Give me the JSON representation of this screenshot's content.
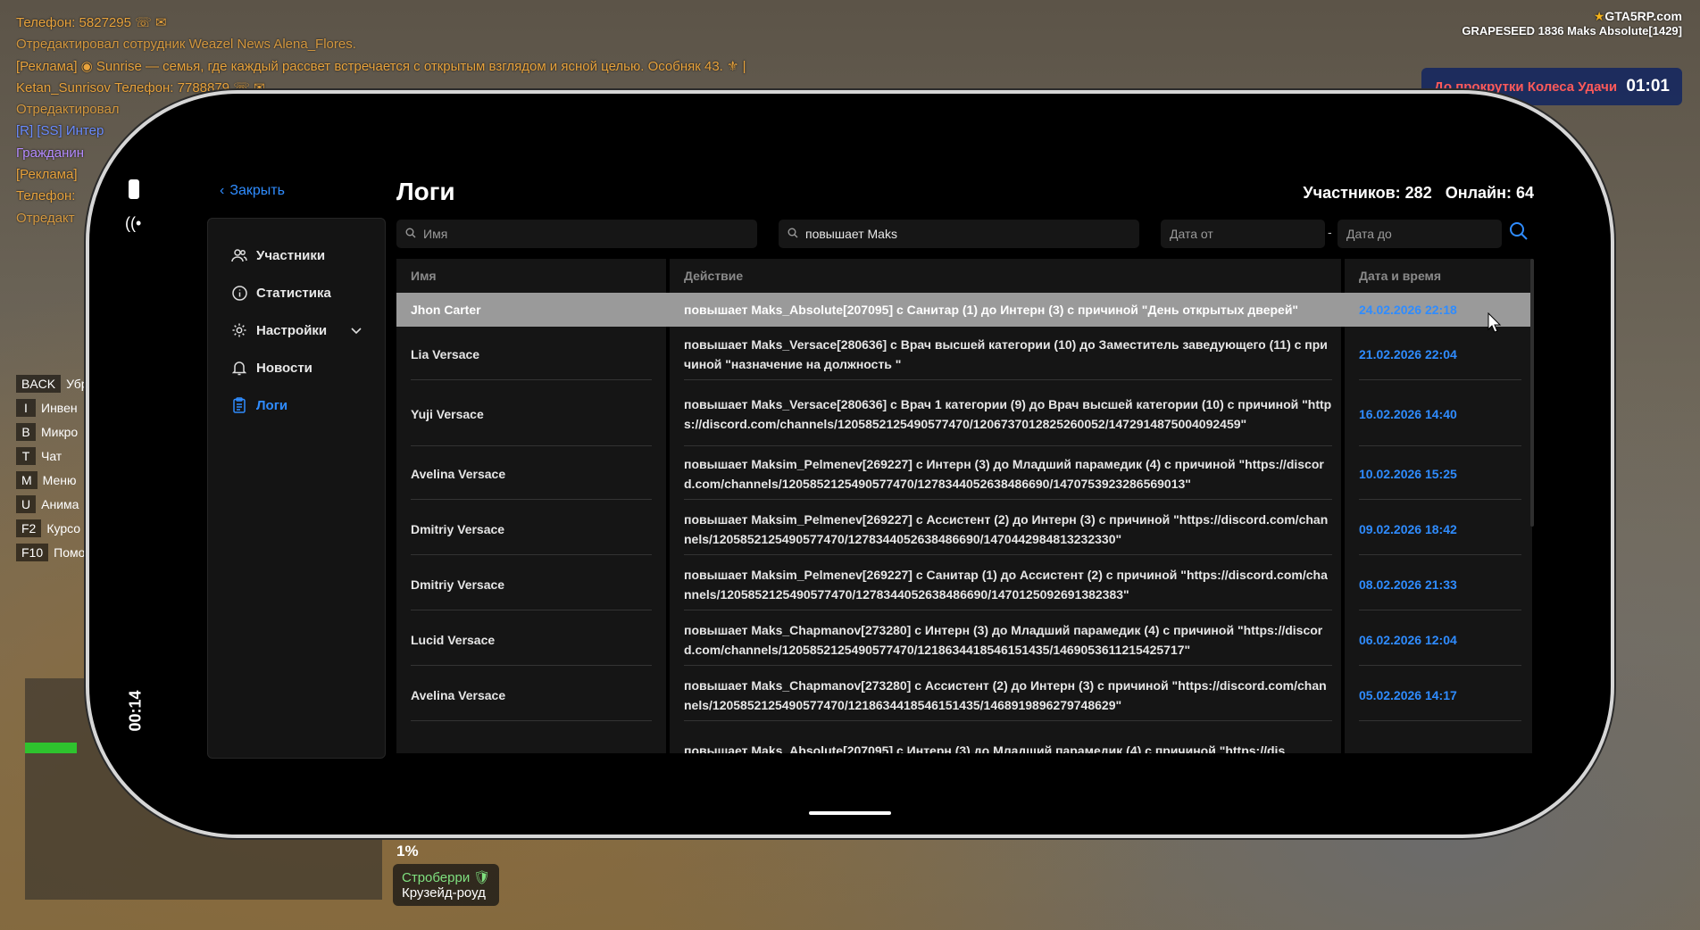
{
  "chat": [
    {
      "text": "Телефон: 5827295 ☏ ✉",
      "color": "orange"
    },
    {
      "text": "Отредактировал сотрудник Weazel News Alena_Flores.",
      "color": "sub"
    },
    {
      "text": "[Реклама] ◉ Sunrise — семья, где каждый рассвет встречается с открытым взглядом и ясной целью. Особняк 43. ⚜ |",
      "color": "orange"
    },
    {
      "text": "Ketan_Sunrisov Телефон: 7788879 ☏ ✉",
      "color": "orange"
    },
    {
      "text": "Отредактировал",
      "color": "sub"
    },
    {
      "text": "[R] [SS] Интер",
      "color": "blue"
    },
    {
      "text": "Гражданин",
      "color": "purple"
    },
    {
      "text": "[Реклама]",
      "color": "orange"
    },
    {
      "text": "Телефон:",
      "color": "orange"
    },
    {
      "text": "Отредакт",
      "color": "sub"
    }
  ],
  "hud": {
    "logo": "GTA5RP.com",
    "server_line": "GRAPESEED 1836 Maks Absolute[1429]",
    "wheel_text": "До прокрутки Колеса Удачи",
    "wheel_time": "01:01",
    "percent": "1%",
    "location_top": "Строберри 🛡",
    "location_bottom": "Крузейд-роуд"
  },
  "keys": [
    {
      "key": "BACK",
      "label": "Убр"
    },
    {
      "key": "I",
      "label": "Инвен"
    },
    {
      "key": "B",
      "label": "Микро"
    },
    {
      "key": "T",
      "label": "Чат"
    },
    {
      "key": "M",
      "label": "Меню"
    },
    {
      "key": "U",
      "label": "Анима"
    },
    {
      "key": "F2",
      "label": "Курсо"
    },
    {
      "key": "F10",
      "label": "Помо"
    }
  ],
  "phone": {
    "clock": "00:14",
    "close_label": "Закрыть",
    "title": "Логи",
    "members_count": "Участников: 282",
    "online_count": "Онлайн: 64"
  },
  "sidebar": {
    "items": [
      {
        "label": "Участники",
        "icon": "users-icon"
      },
      {
        "label": "Статистика",
        "icon": "info-icon"
      },
      {
        "label": "Настройки",
        "icon": "gear-icon"
      },
      {
        "label": "Новости",
        "icon": "bell-icon"
      },
      {
        "label": "Логи",
        "icon": "clipboard-icon"
      }
    ]
  },
  "filters": {
    "name_placeholder": "Имя",
    "action_value": "повышает Maks",
    "date_from_placeholder": "Дата от",
    "date_to_placeholder": "Дата до"
  },
  "table": {
    "headers": {
      "name": "Имя",
      "action": "Действие",
      "date": "Дата и время"
    },
    "rows": [
      {
        "name": "Jhon Carter",
        "action": "повышает Maks_Absolute[207095] с Санитар (1) до Интерн (3) с причиной \"День открытых дверей\"",
        "date": "24.02.2026 22:18"
      },
      {
        "name": "Lia Versace",
        "action": "повышает Maks_Versace[280636] с Врач высшей категории (10) до Заместитель заведующего (11) с причиной \"назначение на должность \"",
        "date": "21.02.2026 22:04"
      },
      {
        "name": "Yuji Versace",
        "action": "повышает Maks_Versace[280636] с Врач 1 категории (9) до Врач высшей категории (10) с причиной \"https://discord.com/channels/1205852125490577470/1206737012825260052/1472914875004092459\"",
        "date": "16.02.2026 14:40"
      },
      {
        "name": "Avelina Versace",
        "action": "повышает Maksim_Pelmenev[269227] с Интерн (3) до Младший парамедик (4) с причиной \"https://discord.com/channels/1205852125490577470/1278344052638486690/1470753923286569013\"",
        "date": "10.02.2026 15:25"
      },
      {
        "name": "Dmitriy Versace",
        "action": "повышает Maksim_Pelmenev[269227] с Ассистент (2) до Интерн (3) с причиной \"https://discord.com/channels/1205852125490577470/1278344052638486690/1470442984813232330\"",
        "date": "09.02.2026 18:42"
      },
      {
        "name": "Dmitriy Versace",
        "action": "повышает Maksim_Pelmenev[269227] с Санитар (1) до Ассистент (2) с причиной \"https://discord.com/channels/1205852125490577470/1278344052638486690/1470125092691382383\"",
        "date": "08.02.2026 21:33"
      },
      {
        "name": "Lucid Versace",
        "action": "повышает Maks_Chapmanov[273280] с Интерн (3) до Младший парамедик (4) с причиной \"https://discord.com/channels/1205852125490577470/1218634418546151435/1469053611215425717\"",
        "date": "06.02.2026 12:04"
      },
      {
        "name": "Avelina Versace",
        "action": "повышает Maks_Chapmanov[273280] с Ассистент (2) до Интерн (3) с причиной \"https://discord.com/channels/1205852125490577470/1218634418546151435/1468919896279748629\"",
        "date": "05.02.2026 14:17"
      },
      {
        "name": "",
        "action": "повышает Maks_Absolute[207095] с Интерн (3) до Младший парамедик (4) с причиной \"https://dis",
        "date": ""
      }
    ]
  },
  "colors": {
    "accent": "#2f8cff",
    "panel": "#151515",
    "highlight": "#9a9a9a"
  }
}
